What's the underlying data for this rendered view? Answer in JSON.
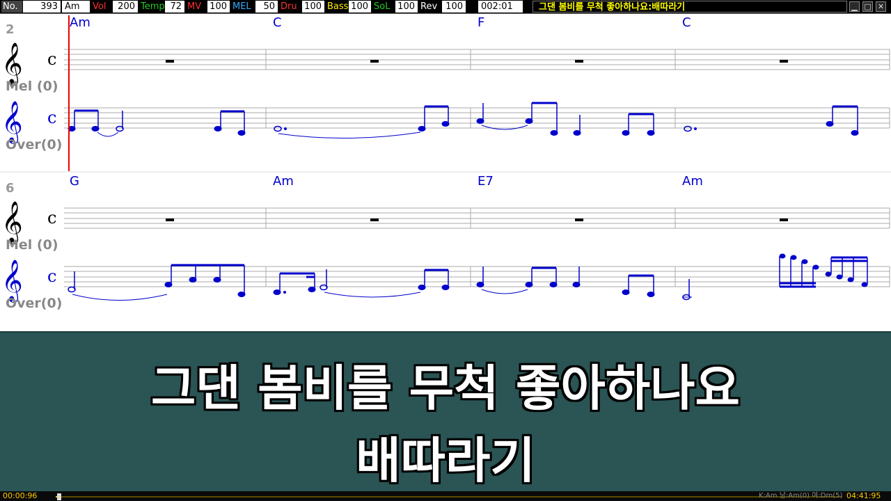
{
  "header": {
    "no_label": "No.",
    "no_value": "393",
    "key_value": "Am",
    "vol_label": "Vol",
    "vol_value": "200",
    "tempo_label": "Temp",
    "tempo_value": "72",
    "mv_label": "MV",
    "mv_value": "100",
    "mel_label": "MEL",
    "mel_value": "50",
    "dru_label": "Dru",
    "dru_value": "100",
    "bass_label": "Bass",
    "bass_value": "100",
    "sol_label": "SoL",
    "sol_value": "100",
    "rev_label": "Rev",
    "rev_value": "100",
    "time": "002:01",
    "song_title": "그댄 봄비를 무척 좋아하나요:배따라기",
    "colors": {
      "vol": "#ff3030",
      "tempo": "#22cc22",
      "mv": "#ff3030",
      "mel": "#33aaff",
      "dru": "#ff3030",
      "bass": "#ffee00",
      "sol": "#22cc22",
      "rev": "#ffffff",
      "title": "#ffff00"
    }
  },
  "window_buttons": [
    {
      "icon": "minimize-icon",
      "glyph": "▁"
    },
    {
      "icon": "maximize-icon",
      "glyph": "□"
    },
    {
      "icon": "close-icon",
      "glyph": "✕"
    }
  ],
  "score": {
    "systems": [
      {
        "measure_number": "2",
        "chords": [
          "Am",
          "C",
          "F",
          "C"
        ],
        "mel_label": "Mel (0)",
        "over_label": "Over(0)",
        "time_signature": "c"
      },
      {
        "measure_number": "6",
        "chords": [
          "G",
          "Am",
          "E7",
          "Am"
        ],
        "mel_label": "Mel (0)",
        "over_label": "Over(0)",
        "time_signature": "c"
      }
    ],
    "note_color": "#0000cc",
    "chord_color": "#0000cc",
    "cursor_color": "#ee0000"
  },
  "lyrics": {
    "line1": "그댄 봄비를 무척 좋아하나요",
    "line2": "배따라기"
  },
  "status": {
    "elapsed": "00:00:96",
    "key_info": "K:Am 남:Am(0) 여:Dm(5)",
    "total": "04:41:95",
    "progress": 0.004
  }
}
